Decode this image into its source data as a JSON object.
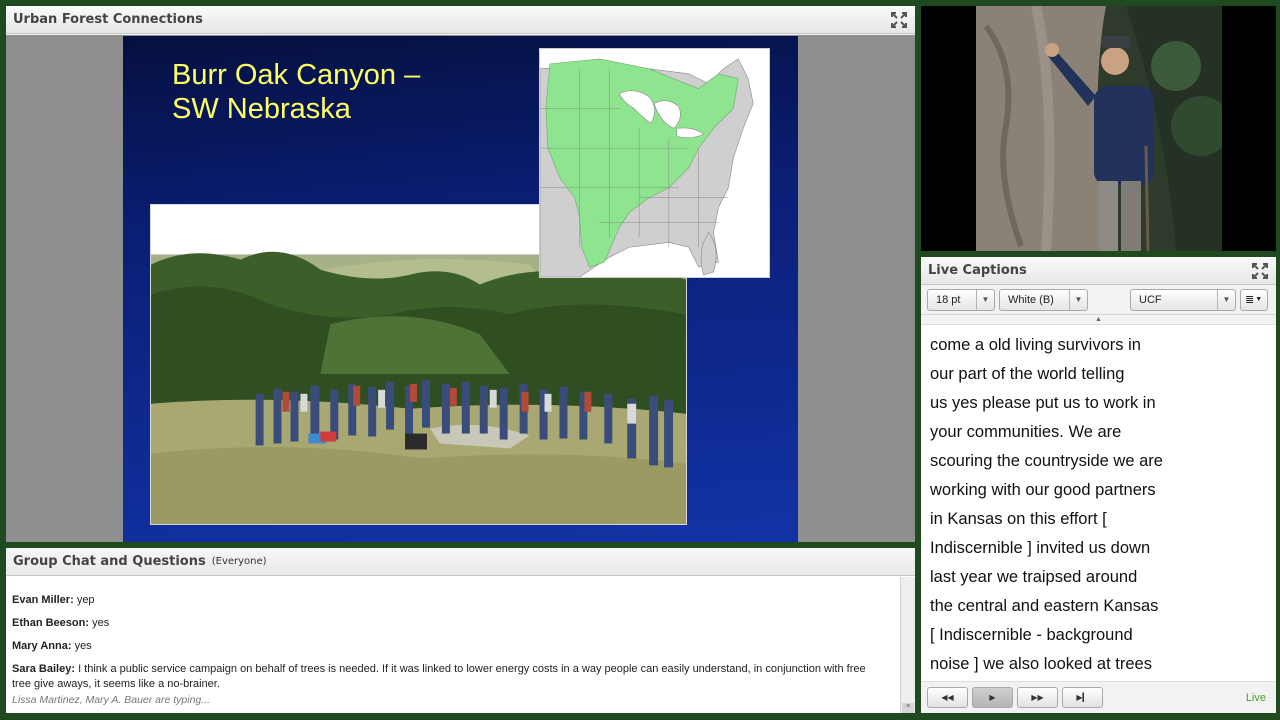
{
  "share_pod": {
    "title": "Urban Forest Connections",
    "slide": {
      "title": "Burr Oak Canyon –\nSW Nebraska",
      "title_color": "#ffff66"
    }
  },
  "captions_pod": {
    "title": "Live Captions",
    "font_size": "18 pt",
    "color_option": "White (B)",
    "source": "UCF",
    "lines": [
      "come a old living survivors in",
      "our part of the world telling",
      "us yes please put us to work in",
      "your communities. We are",
      "scouring the countryside we are",
      "working with our good partners",
      "in Kansas on this effort [",
      "Indiscernible ] invited us down",
      "last year we traipsed around",
      "the central and eastern Kansas",
      "[ Indiscernible - background",
      "noise ] we also looked at trees"
    ],
    "status": "Live",
    "status_color": "#4b9b2e"
  },
  "chat_pod": {
    "title": "Group Chat and Questions",
    "audience": "(Everyone)",
    "messages": [
      {
        "sender": "Evan Miller",
        "text": "yep"
      },
      {
        "sender": "Ethan Beeson",
        "text": "yes"
      },
      {
        "sender": "Mary Anna",
        "text": "yes"
      },
      {
        "sender": "Sara Bailey",
        "text": "I think a public service campaign on behalf of trees is needed. If it was linked to lower energy costs in a way people can easily understand, in conjunction with free tree give aways, it seems like a no-brainer."
      }
    ],
    "typing": "Lissa Martinez, Mary A. Bauer are typing..."
  },
  "colors": {
    "frame": "#1f4a1f",
    "slide_blue": "#0a1e74",
    "map_highlight": "#8fe58f"
  }
}
